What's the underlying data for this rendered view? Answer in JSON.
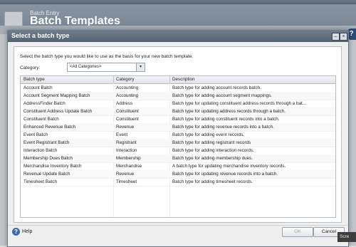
{
  "background": {
    "supertitle": "Batch Entry",
    "title": "Batch Templates"
  },
  "dialog": {
    "title": "Select a batch type",
    "instructions": "Select the batch type you would like to use as the basis for your new batch template.",
    "category_label": "Category:",
    "category_value": "<All Categories>",
    "columns": [
      "Batch type",
      "Category",
      "Description"
    ],
    "rows": [
      {
        "type": "Account Batch",
        "category": "Accounting",
        "description": "Batch type for adding account records batch."
      },
      {
        "type": "Account Segment Mapping Batch",
        "category": "Accounting",
        "description": "Batch type for adding account segment mappings."
      },
      {
        "type": "AddressFinder Batch",
        "category": "Address",
        "description": "Batch type for updating constituent address records through a bat..."
      },
      {
        "type": "Constituent Address Update Batch",
        "category": "Constituent",
        "description": "Batch type for updating address records through a batch."
      },
      {
        "type": "Constituent Batch",
        "category": "Constituent",
        "description": "Batch type for adding constituent records into a batch."
      },
      {
        "type": "Enhanced Revenue Batch",
        "category": "Revenue",
        "description": "Batch type for adding revenue records into a batch."
      },
      {
        "type": "Event Batch",
        "category": "Event",
        "description": "Batch type for adding event records."
      },
      {
        "type": "Event Registrant Batch",
        "category": "Registrant",
        "description": "Batch type for adding registrant records"
      },
      {
        "type": "Interaction Batch",
        "category": "Interaction",
        "description": "Batch type for adding interaction records."
      },
      {
        "type": "Membership Dues Batch",
        "category": "Membership",
        "description": "Batch type for adding membership dues."
      },
      {
        "type": "Merchandise Inventory Batch",
        "category": "Merchandise",
        "description": "A batch type for updating merchandise inventory records."
      },
      {
        "type": "Revenue Update Batch",
        "category": "Revenue",
        "description": "Batch type for updating revenue records into a batch."
      },
      {
        "type": "Timesheet Batch",
        "category": "Timesheet",
        "description": "Batch type for adding timesheet records."
      }
    ],
    "help_label": "Help",
    "ok_label": "OK",
    "cancel_label": "Cancel",
    "help_glyph": "?"
  },
  "taskbar": {
    "label": "Scre"
  },
  "side_help_glyph": "?"
}
